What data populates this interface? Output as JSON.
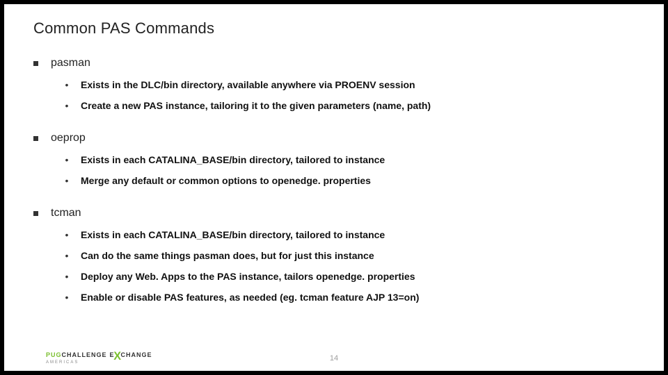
{
  "title": "Common PAS Commands",
  "sections": [
    {
      "heading": "pasman",
      "items": [
        "Exists in the DLC/bin directory, available anywhere via PROENV session",
        "Create a new PAS instance, tailoring it to the given parameters (name, path)"
      ]
    },
    {
      "heading": "oeprop",
      "items": [
        "Exists in each CATALINA_BASE/bin directory, tailored to instance",
        "Merge any default or common options to openedge. properties"
      ]
    },
    {
      "heading": "tcman",
      "items": [
        "Exists in each CATALINA_BASE/bin directory, tailored to instance",
        "Can do the same things pasman does, but for just this instance",
        "Deploy any Web. Apps to the PAS instance, tailors openedge. properties",
        "Enable or disable PAS features, as needed (eg. tcman feature AJP 13=on)"
      ]
    }
  ],
  "footer": {
    "brand_part1": "PUG",
    "brand_part2": "CHALLENGE",
    "brand_part3": "E",
    "brand_part4": "CHANGE",
    "sub": "AMERICAS"
  },
  "page_number": "14"
}
